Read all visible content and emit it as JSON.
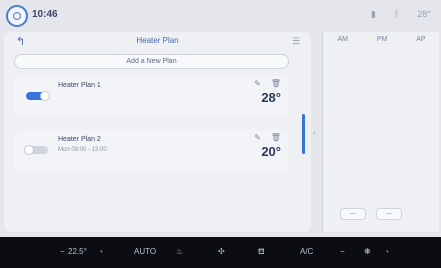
{
  "status": {
    "time": "10:46",
    "temperature": "28°",
    "icons": [
      "signal-icon",
      "bluetooth-icon",
      "temperature-icon"
    ]
  },
  "header": {
    "title": "Heater Plan"
  },
  "add_button": {
    "label": "Add a New Plan"
  },
  "plans": [
    {
      "name": "Heater Plan 1",
      "enabled": true,
      "temperature": "28°"
    },
    {
      "name": "Heater Plan 2",
      "enabled": false,
      "schedule": "Mon 09:00 - 13:00",
      "temperature": "20°"
    }
  ],
  "side": {
    "am": "AM",
    "pm": "PM",
    "ap": "AP"
  },
  "climate": {
    "left_temp": "22.5°",
    "auto_label": "AUTO",
    "ac_label": "A/C"
  }
}
